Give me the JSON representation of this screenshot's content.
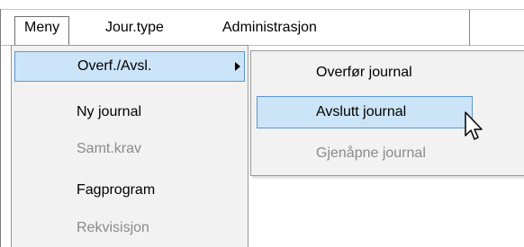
{
  "menubar": {
    "items": [
      {
        "label": "Meny",
        "state": "open"
      },
      {
        "label": "Jour.type"
      },
      {
        "label": "Administrasjon"
      }
    ]
  },
  "menu": {
    "items": [
      {
        "label": "Overf./Avsl.",
        "state": "highlighted",
        "has_submenu": true
      },
      {
        "label": "Ny journal",
        "state": "enabled"
      },
      {
        "label": "Samt.krav",
        "state": "disabled"
      },
      {
        "label": "Fagprogram",
        "state": "enabled"
      },
      {
        "label": "Rekvisisjon",
        "state": "disabled"
      }
    ]
  },
  "submenu": {
    "items": [
      {
        "label": "Overfør journal",
        "state": "enabled"
      },
      {
        "label": "Avslutt journal",
        "state": "highlighted"
      },
      {
        "label": "Gjenåpne journal",
        "state": "disabled"
      }
    ]
  },
  "colors": {
    "highlight_fill": "#cce4f7",
    "highlight_border": "#5b96d3",
    "menu_background": "#f2f2f2",
    "disabled_text": "#8a8a8a"
  },
  "cursor": {
    "icon": "mouse-pointer-icon"
  }
}
